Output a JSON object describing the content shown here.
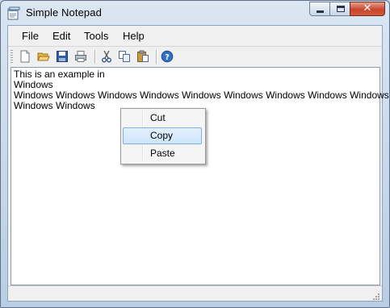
{
  "window": {
    "title": "Simple Notepad",
    "icon": "notepad-app-icon",
    "caption_buttons": [
      "minimize-icon",
      "maximize-icon",
      "close-icon"
    ]
  },
  "menu": {
    "items": [
      {
        "label": "File"
      },
      {
        "label": "Edit"
      },
      {
        "label": "Tools"
      },
      {
        "label": "Help"
      }
    ]
  },
  "toolbar": {
    "buttons": [
      "new-file-icon",
      "open-folder-icon",
      "save-icon",
      "print-icon",
      "cut-icon",
      "copy-icon",
      "paste-icon",
      "help-icon"
    ]
  },
  "editor": {
    "lines": [
      "This is an example in",
      " Windows",
      " Windows Windows Windows Windows Windows Windows Windows Windows Windows",
      "Windows Windows"
    ]
  },
  "context_menu": {
    "items": [
      {
        "label": "Cut",
        "highlighted": false
      },
      {
        "label": "Copy",
        "highlighted": true
      },
      {
        "label": "Paste",
        "highlighted": false
      }
    ]
  },
  "colors": {
    "title_bar": "#c9d6e4",
    "close_button": "#c7462d",
    "highlight_border": "#7fb0e0",
    "highlight_fill": "#cde6fb"
  }
}
